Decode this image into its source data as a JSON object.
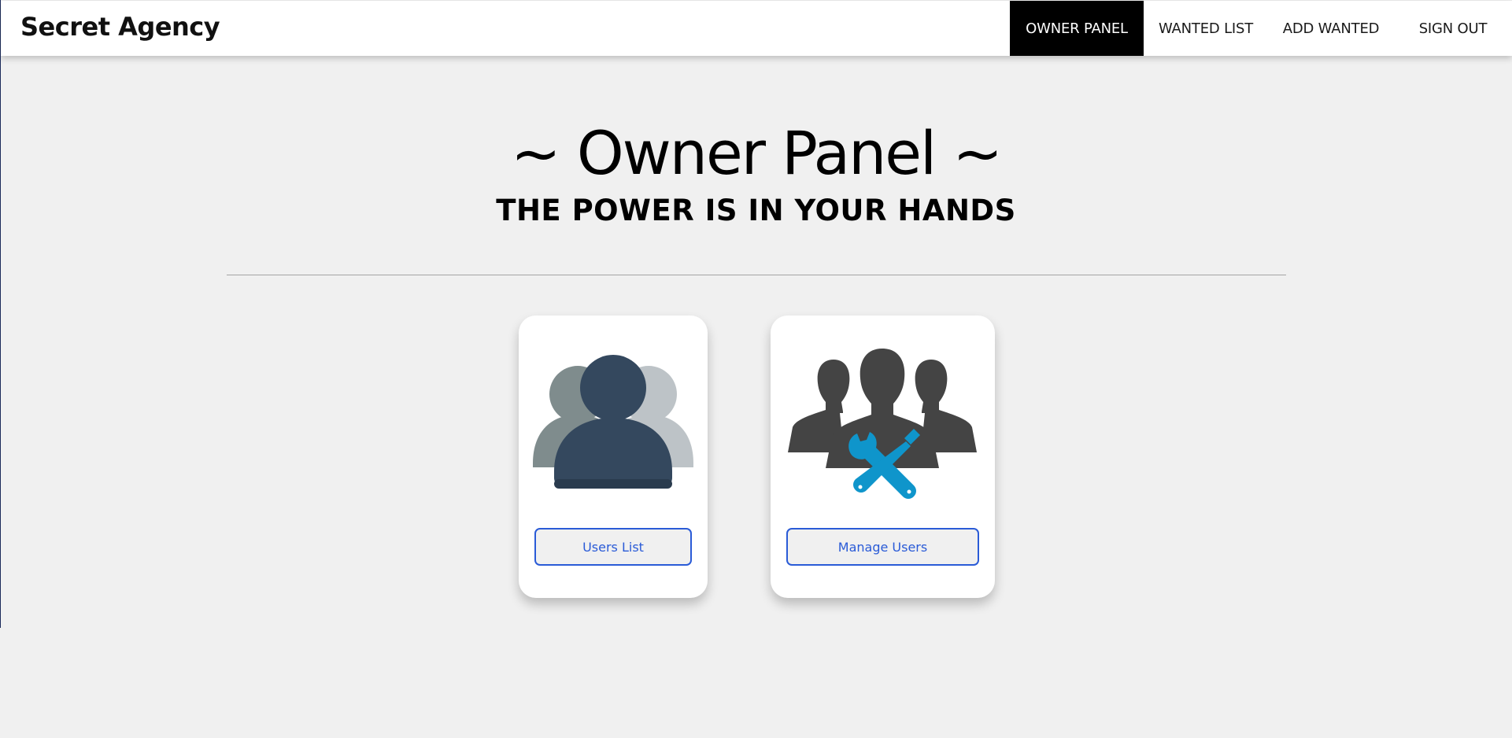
{
  "app": {
    "brand": "Secret Agency"
  },
  "nav": {
    "items": [
      {
        "label": "OWNER PANEL",
        "active": true
      },
      {
        "label": "WANTED LIST",
        "active": false
      },
      {
        "label": "ADD WANTED",
        "active": false
      },
      {
        "label": "SIGN OUT",
        "active": false
      }
    ]
  },
  "main": {
    "title": "~ Owner Panel ~",
    "subtitle": "THE POWER IS IN YOUR HANDS"
  },
  "cards": [
    {
      "icon": "users-group-icon",
      "button_label": "Users List"
    },
    {
      "icon": "manage-users-tools-icon",
      "button_label": "Manage Users"
    }
  ],
  "colors": {
    "background": "#f0f0f0",
    "nav_active_bg": "#000000",
    "button_accent": "#2a5bd7",
    "user_icon_front": "#34485e",
    "user_icon_left": "#7f8c8d",
    "user_icon_right": "#bdc3c7",
    "silhouette": "#444444",
    "tools": "#0f95cb"
  }
}
